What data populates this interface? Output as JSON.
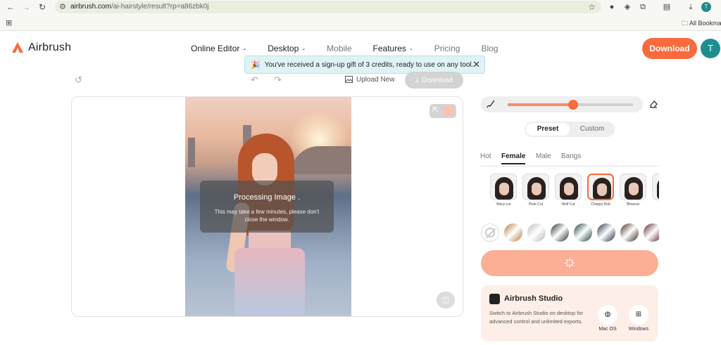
{
  "browser": {
    "url_host": "airbrush.com",
    "url_path": "/ai-hairstyle/result?rp=a86zbk0j",
    "profile_initial": "T",
    "bookmarks_label": "All Bookmar"
  },
  "header": {
    "logo_text": "Airbrush",
    "nav": [
      {
        "label": "Online Editor",
        "has_caret": true
      },
      {
        "label": "Desktop",
        "has_caret": true
      },
      {
        "label": "Mobile",
        "has_caret": false
      },
      {
        "label": "Features",
        "has_caret": true
      },
      {
        "label": "Pricing",
        "has_caret": false
      },
      {
        "label": "Blog",
        "has_caret": false
      }
    ],
    "download_label": "Download",
    "avatar_initial": "T",
    "accent_color": "#fa6a3c"
  },
  "toast": {
    "message": "You've received a sign-up gift of 3 credits, ready to use on any tool."
  },
  "toolbar": {
    "upload_label": "Upload New",
    "download_label": "Download"
  },
  "canvas": {
    "overlay_title": "Processing Image .",
    "overlay_text": "This may take a few minutes, please don't close the window."
  },
  "panel": {
    "brush_size_fraction": 0.52,
    "mode_preset": "Preset",
    "mode_custom": "Custom",
    "tabs": [
      "Hot",
      "Female",
      "Male",
      "Bangs"
    ],
    "active_tab": "Female",
    "styles": [
      {
        "label": "Wavy cut",
        "selected": false
      },
      {
        "label": "Pixie Cut",
        "selected": false
      },
      {
        "label": "Wolf Cut",
        "selected": false
      },
      {
        "label": "Choppy Bob",
        "selected": true
      },
      {
        "label": "Blowout",
        "selected": false
      },
      {
        "label": "Sh",
        "selected": false
      }
    ],
    "swatches": [
      {
        "name": "none"
      },
      {
        "name": "golden-brown",
        "color": "#b9773a"
      },
      {
        "name": "silver",
        "color": "#b8b8b8"
      },
      {
        "name": "black-green",
        "color": "#1e2b22"
      },
      {
        "name": "black-teal",
        "color": "#123d3a"
      },
      {
        "name": "black-blue",
        "color": "#1d2a3f"
      },
      {
        "name": "dark-brown",
        "color": "#3a2418"
      },
      {
        "name": "burgundy",
        "color": "#5a1d28"
      }
    ]
  },
  "studio": {
    "title": "Airbrush Studio",
    "description": "Switch to Airbrush Studio on desktop for advanced control and unlimited exports.",
    "platforms": [
      {
        "label": "Mac OS",
        "icon": "apple-icon"
      },
      {
        "label": "Windows",
        "icon": "windows-icon"
      }
    ]
  }
}
